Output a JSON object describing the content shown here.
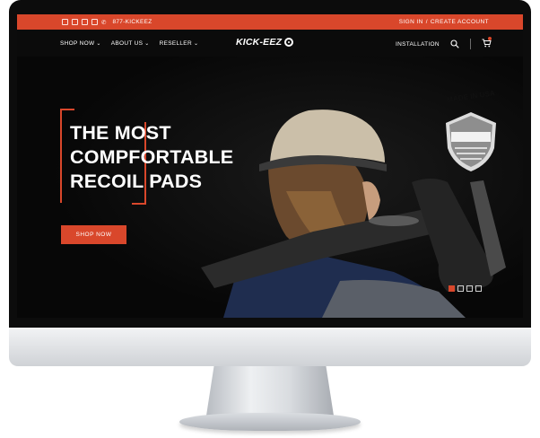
{
  "topbar": {
    "social_icons": [
      "facebook-icon",
      "instagram-icon",
      "linkedin-icon",
      "twitter-icon"
    ],
    "phone": "877-KICKEEZ",
    "sign_in": "SIGN IN",
    "separator": "/",
    "create_account": "CREATE ACCOUNT"
  },
  "nav": {
    "items": [
      {
        "label": "SHOP NOW"
      },
      {
        "label": "ABOUT US"
      },
      {
        "label": "RESELLER"
      }
    ],
    "logo": "KICK-EEZ",
    "installation": "INSTALLATION"
  },
  "hero": {
    "headline": [
      "THE MOST",
      "COMPFORTABLE",
      "RECOIL PADS"
    ],
    "cta": "SHOP NOW",
    "badge": "MADE IN USA",
    "slides": {
      "count": 4,
      "active": 1
    }
  },
  "colors": {
    "accent": "#d9472b",
    "background": "#0b0b0b",
    "text": "#ffffff"
  }
}
